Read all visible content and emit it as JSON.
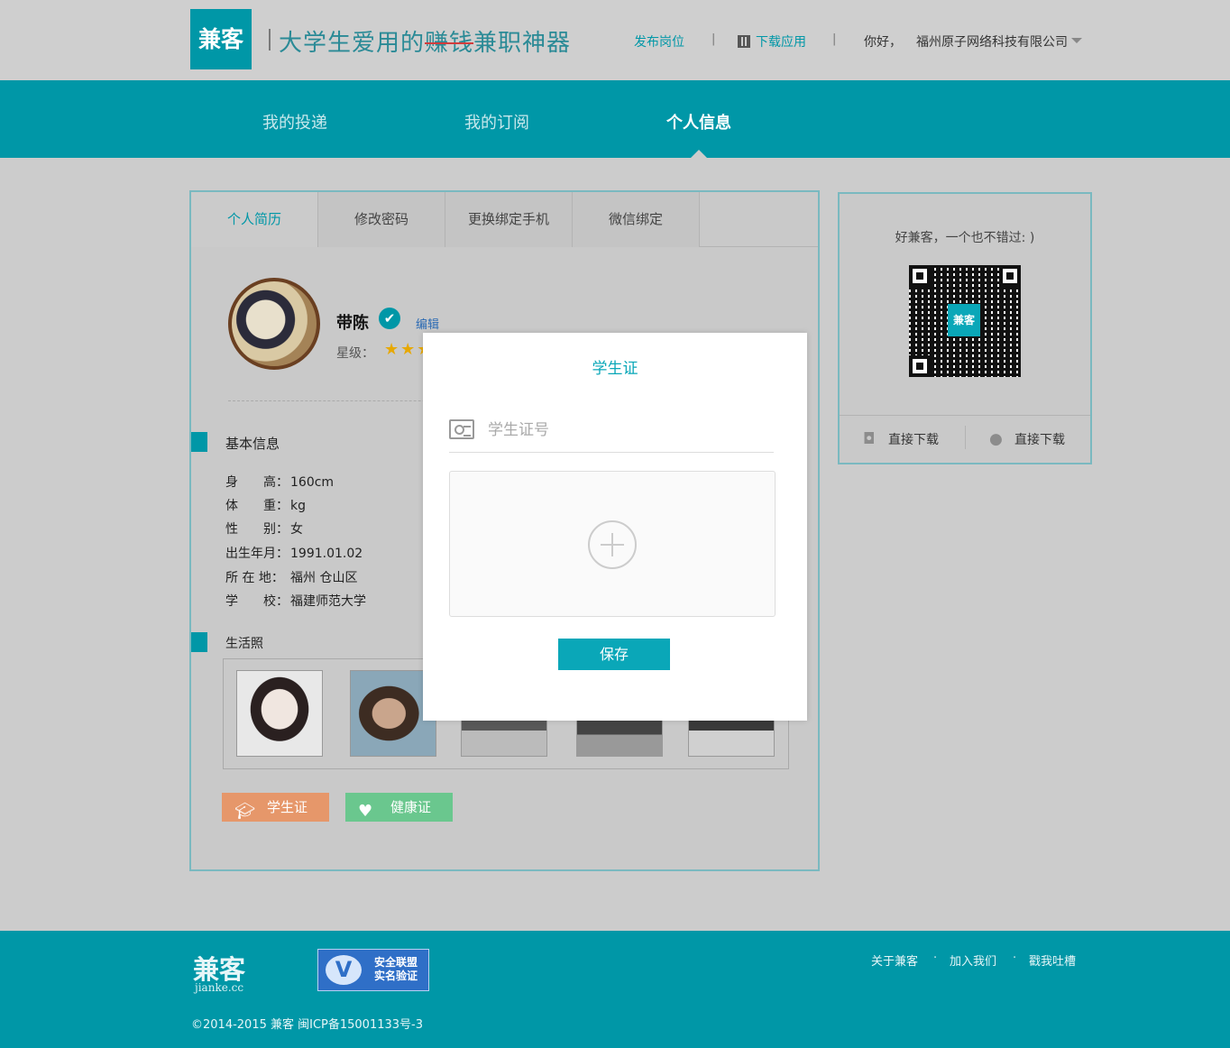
{
  "header": {
    "logo_text": "兼客",
    "slogan_prefix": "大学生爱用的",
    "slogan_struck": "赚钱",
    "slogan_suffix": "兼职神器",
    "post_job": "发布岗位",
    "download_app": "下载应用",
    "greeting": "你好，",
    "company": "福州原子网络科技有限公司",
    "separator": "|"
  },
  "mainnav": {
    "items": [
      "我的投递",
      "我的订阅",
      "个人信息"
    ],
    "active_index": 2
  },
  "tabs": {
    "items": [
      "个人简历",
      "修改密码",
      "更换绑定手机",
      "微信绑定"
    ],
    "active_index": 0
  },
  "profile": {
    "name": "带陈",
    "verified_mark": "✔",
    "edit": "编辑",
    "stars_label": "星级：",
    "stars": "★★★"
  },
  "basic_info": {
    "title": "基本信息",
    "rows": [
      {
        "key": "身　　高：",
        "value": "160cm"
      },
      {
        "key": "体　　重：",
        "value": "kg"
      },
      {
        "key": "性　　别：",
        "value": "女"
      },
      {
        "key": "出生年月：",
        "value": "1991.01.02"
      },
      {
        "key": "所 在 地：",
        "value": "福州 仓山区"
      },
      {
        "key": "学　　校：",
        "value": "福建师范大学"
      }
    ]
  },
  "photos": {
    "title": "生活照"
  },
  "certs": {
    "student": "学生证",
    "student_icon": "graduation-cap-icon",
    "health": "健康证",
    "health_icon": "heart-pulse-icon"
  },
  "side": {
    "message": "好兼客，一个也不错过: )",
    "qr_center": "兼客",
    "android_download": "直接下载",
    "ios_download": "直接下载"
  },
  "footer": {
    "logo": "兼客",
    "logo_sub": "jianke.cc",
    "badge_line1": "安全联盟",
    "badge_line2": "实名验证",
    "badge_mark": "V",
    "copyright": "©2014-2015 兼客 闽ICP备15001133号-3",
    "links": [
      "关于兼客",
      "加入我们",
      "戳我吐槽"
    ],
    "dot": "·"
  },
  "modal": {
    "title": "学生证",
    "input_placeholder": "学生证号",
    "input_value": "",
    "save": "保存"
  },
  "colors": {
    "brand": "#0097a7",
    "modal_accent": "#0aa7b8",
    "student_button": "#e6976a",
    "health_button": "#6ac78e"
  }
}
